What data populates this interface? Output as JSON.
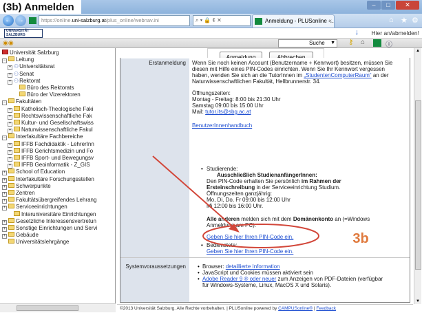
{
  "title_overlay": "(3b) Anmelden",
  "browser": {
    "url_prefix": "https://online.",
    "url_domain": "uni-salzburg.at",
    "url_rest": "/plus_online/webnav.ini",
    "address_tools": "⌕ ▾ 🔒 ¢ ✕",
    "tab_title": "Anmeldung - PLUSonline -...",
    "tab_close": "×"
  },
  "header": {
    "logo_line1": "UNIVERSITÄT",
    "logo_line2": "SALZBURG",
    "hier_text": "Hier an/abmelden!"
  },
  "toolbar": {
    "search_label": "Suche"
  },
  "tree": [
    {
      "label": "Universität Salzburg",
      "type": "root"
    },
    {
      "label": "Leitung",
      "type": "folder",
      "toggle": "−"
    },
    {
      "label": "Universitätsrat",
      "type": "people",
      "toggle": "+"
    },
    {
      "label": "Senat",
      "type": "people",
      "toggle": "+"
    },
    {
      "label": "Rektorat",
      "type": "people",
      "toggle": "+"
    },
    {
      "label": "Büro des Rektorats",
      "type": "folder",
      "toggle": ""
    },
    {
      "label": "Büro der Vizerektoren",
      "type": "folder",
      "toggle": ""
    },
    {
      "label": "Fakultäten",
      "type": "folder",
      "toggle": "−"
    },
    {
      "label": "Katholisch-Theologische Faki",
      "type": "folder",
      "toggle": "+"
    },
    {
      "label": "Rechtswissenschaftliche Fak",
      "type": "folder",
      "toggle": "+"
    },
    {
      "label": "Kultur- und Gesellschaftswiss",
      "type": "folder",
      "toggle": "+"
    },
    {
      "label": "Naturwissenschaftliche Fakul",
      "type": "folder",
      "toggle": "+"
    },
    {
      "label": "Interfakultäre Fachbereiche",
      "type": "folder",
      "toggle": "−"
    },
    {
      "label": "IFFB Fachdidaktik - LehrerInn",
      "type": "folder",
      "toggle": "+"
    },
    {
      "label": "IFFB Gerichtsmedizin und Fo",
      "type": "folder",
      "toggle": "+"
    },
    {
      "label": "IFFB Sport- und Bewegungsv",
      "type": "folder",
      "toggle": "+"
    },
    {
      "label": "IFFB Geoinformatik - Z_GIS",
      "type": "folder",
      "toggle": "+"
    },
    {
      "label": "School of Education",
      "type": "folder",
      "toggle": "+"
    },
    {
      "label": "Interfakultäre Forschungsstellen",
      "type": "folder",
      "toggle": "+"
    },
    {
      "label": "Schwerpunkte",
      "type": "folder",
      "toggle": "+"
    },
    {
      "label": "Zentren",
      "type": "folder",
      "toggle": "+"
    },
    {
      "label": "Fakultätsübergreifendes Lehrang",
      "type": "folder",
      "toggle": "+"
    },
    {
      "label": "Serviceeinrichtungen",
      "type": "folder",
      "toggle": "+"
    },
    {
      "label": "Interuniversitäre Einrichtungen",
      "type": "folder",
      "toggle": ""
    },
    {
      "label": "Gesetzliche Interessensvertretun",
      "type": "folder",
      "toggle": "+"
    },
    {
      "label": "Sonstige Einrichtungen und Servi",
      "type": "folder",
      "toggle": "+"
    },
    {
      "label": "Gebäude",
      "type": "folder",
      "toggle": "+"
    },
    {
      "label": "Universitätslehrgänge",
      "type": "folder",
      "toggle": ""
    }
  ],
  "content": {
    "btn_login": "Anmeldung",
    "btn_cancel": "Abbrechen",
    "label_erstanmeldung": "Erstanmeldung",
    "para1_a": "Wenn Sie noch keinen Account (Benutzername + Kennwort) besitzen, müssen Sie",
    "para1_b": "diesen mit Hilfe eines PIN-Codes einrichten. Wenn Sie Ihr Kennwort vergessen",
    "para1_c_pre": "haben, wenden Sie sich an die TutorInnen im ",
    "para1_c_link": "„StudentenComputerRaum“",
    "para1_c_post": " an der",
    "para1_d": "Naturwissenschaftlichen Fakultät, Hellbrunnerstr. 34.",
    "hours_title": "Öffnungszeiten:",
    "hours_1": "Montag - Freitag: 8:00 bis 21:30 Uhr",
    "hours_2": "Samstag 09:00 bis 15:00 Uhr",
    "mail_pre": "Mail: ",
    "mail_link": "tutor.its@sbg.ac.at",
    "handbook_link": "BenutzerInnenhandbuch",
    "stud_label": "Studierende:",
    "stud_bold1": "Ausschließlich StudienanfängerInnen:",
    "stud_l2_pre": "Den PIN-Code erhalten Sie persönlich ",
    "stud_l2_bold": "im Rahmen der",
    "stud_l3_bold": "Ersteinschreibung",
    "stud_l3_post": " in der Serviceeinrichtung Studium.",
    "stud_l4": "Öffnungszeiten ganzjährig:",
    "stud_l5": "Mo, Di, Do, Fr 09:00 bis 12:00 Uhr",
    "stud_l6": "Mi 12:00 bis 16:00 Uhr.",
    "others_bold": "Alle anderen",
    "others_mid": " melden sich mit dem ",
    "others_bold2": "Domänenkonto",
    "others_post": " an (=Windows",
    "others_l2": "Anmeldung am PC).",
    "pin_link1": "Geben Sie hier Ihren PIN-Code ein.",
    "staff_label": "Bedienstete:",
    "pin_link2": "Geben Sie hier Ihren PIN-Code ein.",
    "label_system": "Systemvoraussetzungen",
    "sys_1_pre": "Browser: ",
    "sys_1_link": "detaillierte Information",
    "sys_2": "JavaScript und Cookies müssen aktiviert sein",
    "sys_3_link": "Adobe Reader 9 ® oder neuer",
    "sys_3_post": " zum Anzeigen von PDF-Dateien (verfügbar",
    "sys_3_l2": "für Windows-Systeme, Linux, MacOS X und Solaris).",
    "step_badge": "3b"
  },
  "footer": {
    "text": "©2013 Universität Salzburg. Alle Rechte vorbehalten. | PLUSonline powered by ",
    "link1": "CAMPUSonline®",
    "sep": " | ",
    "link2": "Feedback"
  },
  "colors": {
    "annotation": "#d2473a",
    "badge": "#e07a3e",
    "link": "#1f4fd1"
  }
}
